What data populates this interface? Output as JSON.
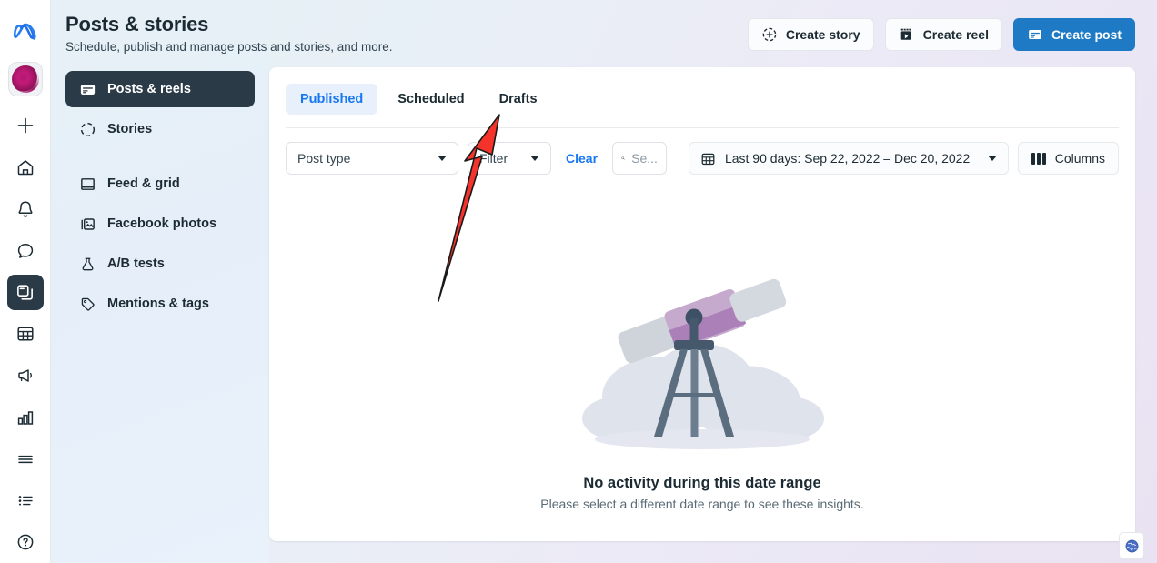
{
  "rail": {
    "logo": "meta-logo",
    "avatar_alt": "profile-avatar",
    "items": [
      {
        "name": "create",
        "icon": "plus-icon"
      },
      {
        "name": "home",
        "icon": "home-icon"
      },
      {
        "name": "notifications",
        "icon": "bell-icon"
      },
      {
        "name": "messages",
        "icon": "chat-bubble-icon"
      },
      {
        "name": "posts",
        "icon": "posts-icon",
        "active": true
      },
      {
        "name": "planner",
        "icon": "calendar-grid-icon"
      },
      {
        "name": "ads",
        "icon": "megaphone-icon"
      },
      {
        "name": "insights",
        "icon": "bar-chart-icon"
      },
      {
        "name": "menu",
        "icon": "hamburger-icon"
      },
      {
        "name": "list",
        "icon": "bullet-list-icon"
      },
      {
        "name": "help",
        "icon": "question-circle-icon"
      }
    ]
  },
  "sidebar": {
    "items": [
      {
        "label": "Posts & reels",
        "icon": "posts-icon",
        "active": true
      },
      {
        "label": "Stories",
        "icon": "stories-ring-icon",
        "active": false
      },
      {
        "label": "Feed & grid",
        "icon": "feed-grid-icon",
        "active": false
      },
      {
        "label": "Facebook photos",
        "icon": "photos-icon",
        "active": false
      },
      {
        "label": "A/B tests",
        "icon": "flask-icon",
        "active": false
      },
      {
        "label": "Mentions & tags",
        "icon": "tag-icon",
        "active": false
      }
    ],
    "collapse_label": "collapse-panel"
  },
  "header": {
    "title": "Posts & stories",
    "subtitle": "Schedule, publish and manage posts and stories, and more.",
    "actions": [
      {
        "label": "Create story",
        "icon": "story-plus-icon",
        "primary": false
      },
      {
        "label": "Create reel",
        "icon": "reel-icon",
        "primary": false
      },
      {
        "label": "Create post",
        "icon": "post-icon",
        "primary": true
      }
    ]
  },
  "tabs": [
    {
      "label": "Published",
      "active": true
    },
    {
      "label": "Scheduled",
      "active": false
    },
    {
      "label": "Drafts",
      "active": false
    }
  ],
  "toolbar": {
    "post_type": "Post type",
    "filter": "Filter",
    "clear": "Clear",
    "search_placeholder": "Se...",
    "search_value": "",
    "date_range": "Last 90 days: Sep 22, 2022 – Dec 20, 2022",
    "columns": "Columns"
  },
  "empty_state": {
    "illustration": "telescope-illustration",
    "title": "No activity during this date range",
    "subtitle": "Please select a different date range to see these insights."
  },
  "footer": {
    "globe": "globe-icon"
  },
  "annotation": {
    "type": "red-arrow",
    "points_to": "Drafts",
    "color": "#f5332b"
  },
  "colors": {
    "accent_blue": "#1877f2",
    "primary_button": "#1e7ac4",
    "dark_nav": "#2b3a47",
    "annotation_red": "#f5332b"
  }
}
